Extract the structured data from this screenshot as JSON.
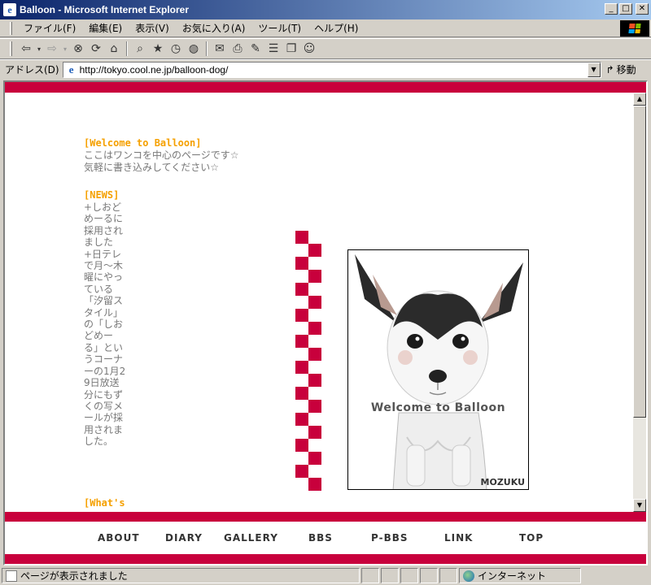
{
  "window": {
    "title": "Balloon - Microsoft Internet Explorer",
    "minimize": "_",
    "maximize": "□",
    "close": "✕"
  },
  "menu": [
    "ファイル(F)",
    "編集(E)",
    "表示(V)",
    "お気に入り(A)",
    "ツール(T)",
    "ヘルプ(H)"
  ],
  "toolbar": {
    "icons": [
      "back-icon",
      "forward-icon",
      "stop-icon",
      "refresh-icon",
      "home-icon",
      "search-icon",
      "favorites-icon",
      "history-icon",
      "media-icon",
      "mail-icon",
      "print-icon",
      "edit-icon",
      "discuss-icon",
      "messenger-icon"
    ]
  },
  "address": {
    "label": "アドレス(D)",
    "url": "http://tokyo.cool.ne.jp/balloon-dog/",
    "go_label": "移動"
  },
  "page": {
    "welcome_title": "[Welcome to Balloon]",
    "intro_line1": "ここはワンコを中心のページです☆",
    "intro_line2": "気軽に書き込みしてください☆",
    "news_title": "[NEWS]",
    "news_body": "+しおどめーるに採用されました+日テレで月〜木曜にやっている「汐留スタイル」の「しおどめーる」というコーナーの1月29日放送分にもずくの写メールが採用されました。",
    "whats_title": "[What's",
    "photo_caption": "Welcome to Balloon",
    "photo_signature": "MOZUKU"
  },
  "nav": [
    "ABOUT",
    "DIARY",
    "GALLERY",
    "BBS",
    "P-BBS",
    "LINK",
    "TOP"
  ],
  "status": {
    "text": "ページが表示されました",
    "zone": "インターネット"
  },
  "colors": {
    "accent": "#c8003c",
    "heading": "#f5a000",
    "body_text": "#777777"
  }
}
